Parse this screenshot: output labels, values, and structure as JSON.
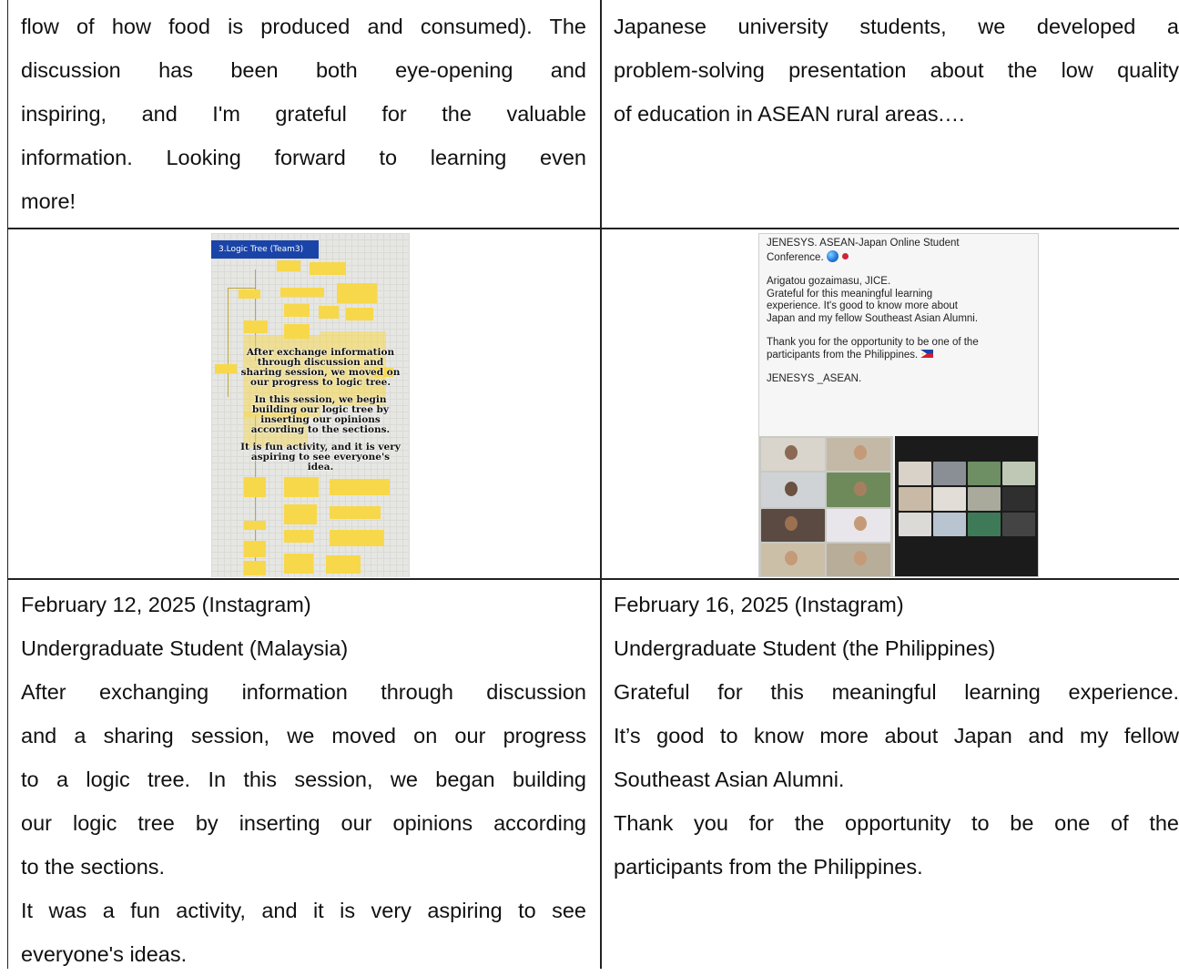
{
  "left_top": {
    "lines": [
      "flow of how food is produced and consumed). The",
      "discussion has been both eye-opening and",
      "inspiring, and I'm grateful for the valuable",
      "information. Looking forward to learning even",
      "more!"
    ]
  },
  "right_top": {
    "lines": [
      "Japanese university students, we developed a",
      "problem-solving presentation about the low quality",
      "of education in ASEAN rural areas.…"
    ]
  },
  "logic_image": {
    "header": "3.Logic Tree (Team3)",
    "overlay_lines": [
      "After exchange information",
      "through discussion and",
      "sharing session, we moved on",
      "our progress to logic tree.",
      "",
      "In this session, we begin",
      "building our logic tree by",
      "inserting our opinions",
      "according to the sections.",
      "",
      "It is fun activity, and it is very",
      "aspiring to see everyone's idea."
    ]
  },
  "post_image": {
    "title_line1": "JENESYS. ASEAN-Japan Online Student",
    "title_line2": "Conference.",
    "para1_l1": "Arigatou gozaimasu, JICE.",
    "para1_l2": "Grateful for this meaningful learning",
    "para1_l3": "experience. It's good to know more about",
    "para1_l4": "Japan and my fellow Southeast Asian Alumni.",
    "para2_l1": "Thank you for the opportunity to be one of the",
    "para2_l2": "participants from the Philippines.",
    "tag": "JENESYS _ASEAN."
  },
  "left_bottom": {
    "date": "February 12, 2025 (Instagram)",
    "author": "Undergraduate Student (Malaysia)",
    "lines": [
      "After exchanging information through discussion",
      "and a sharing session, we moved on our progress",
      "to a logic tree. In this session, we began building",
      "our logic tree by inserting our opinions according",
      "to the sections.",
      "It was a fun activity, and it is very aspiring to see",
      "everyone's ideas."
    ]
  },
  "right_bottom": {
    "date": "February 16, 2025 (Instagram)",
    "author": "Undergraduate Student (the Philippines)",
    "lines": [
      "Grateful for this meaningful learning experience.",
      "It’s good to know more about Japan and my fellow",
      "Southeast Asian Alumni.",
      "Thank you for the opportunity to be one of the",
      "participants from the Philippines."
    ]
  },
  "colors": {
    "border": "#222222",
    "logic_header_bg": "#1a44a8",
    "sticky_note": "#f7d84a"
  }
}
